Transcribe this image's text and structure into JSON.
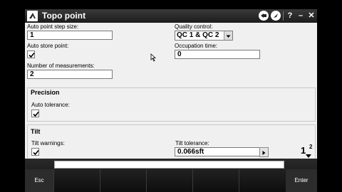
{
  "window": {
    "title": "Topo point"
  },
  "titlebar_icons": [
    "app-logo-icon",
    "satellite-icon",
    "compass-icon",
    "help-icon",
    "minimize-icon",
    "close-icon"
  ],
  "titlebar_labels": {
    "help": "?",
    "minimize": "–",
    "close": "✕"
  },
  "fields": {
    "auto_point_step_size": {
      "label": "Auto point step size:",
      "value": "1"
    },
    "auto_store_point": {
      "label": "Auto store point:",
      "checked": true
    },
    "number_of_measurements": {
      "label": "Number of measurements:",
      "value": "2"
    },
    "quality_control": {
      "label": "Quality control:",
      "value": "QC 1 & QC 2"
    },
    "occupation_time": {
      "label": "Occupation time:",
      "value": "0"
    }
  },
  "precision": {
    "title": "Precision",
    "auto_tolerance": {
      "label": "Auto tolerance:",
      "checked": true
    }
  },
  "tilt": {
    "title": "Tilt",
    "tilt_warnings": {
      "label": "Tilt warnings:",
      "checked": true
    },
    "tilt_tolerance": {
      "label": "Tilt tolerance:",
      "value": "0.066sft"
    }
  },
  "page_indicator": {
    "current": "1",
    "total": "2"
  },
  "softkeys": {
    "esc": "Esc",
    "enter": "Enter"
  },
  "colors": {
    "titlebar": "#2a2a2a",
    "form_bg": "#f0f0f0",
    "softkey_bar": "#1a1a1a"
  }
}
